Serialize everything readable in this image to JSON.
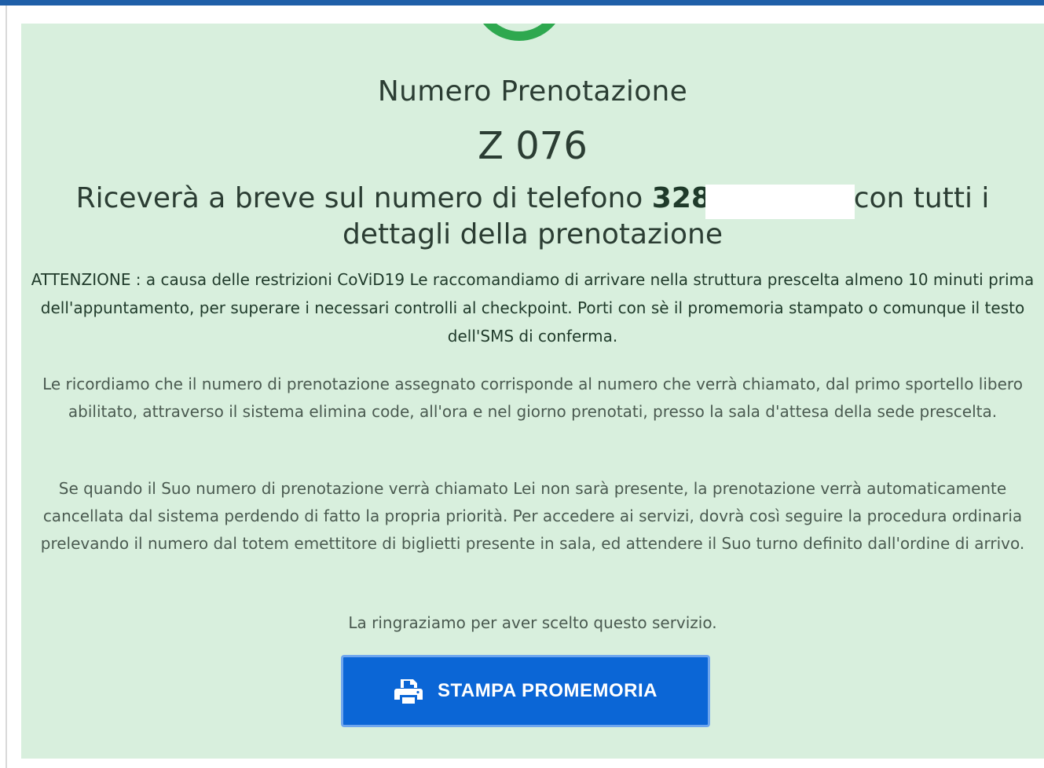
{
  "confirmation": {
    "heading": "Numero Prenotazione",
    "booking_code": "Z 076",
    "sms_notice_prefix": "Riceverà a breve sul numero di telefono ",
    "phone_number": "3288",
    "sms_notice_suffix": "un SMS con tutti i dettagli della prenotazione",
    "warning": "ATTENZIONE : a causa delle restrizioni CoViD19 Le raccomandiamo di arrivare nella struttura prescelta almeno 10 minuti prima dell'appuntamento, per superare i necessari controlli al checkpoint. Porti con sè il promemoria stampato o comunque il testo dell'SMS di conferma.",
    "info_paragraph_1": "Le ricordiamo che il numero di prenotazione assegnato corrisponde al numero che verrà chiamato, dal primo sportello libero abilitato, attraverso il sistema elimina code, all'ora e nel giorno prenotati, presso la sala d'attesa della sede prescelta.",
    "info_paragraph_2": "Se quando il Suo numero di prenotazione verrà chiamato Lei non sarà presente, la prenotazione verrà automaticamente cancellata dal sistema perdendo di fatto la propria priorità. Per accedere ai servizi, dovrà così seguire la procedura ordinaria prelevando il numero dal totem emettitore di biglietti presente in sala, ed attendere il Suo turno definito dall'ordine di arrivo.",
    "thanks": "La ringraziamo per aver scelto questo servizio.",
    "print_button_label": "STAMPA PROMEMORIA",
    "print_icon": "printer-icon",
    "success_icon": "check-circle-icon"
  },
  "colors": {
    "panel_background": "#d8efdd",
    "success_green": "#2ea84f",
    "button_blue": "#0b66d6",
    "top_bar": "#1f5fa8"
  }
}
